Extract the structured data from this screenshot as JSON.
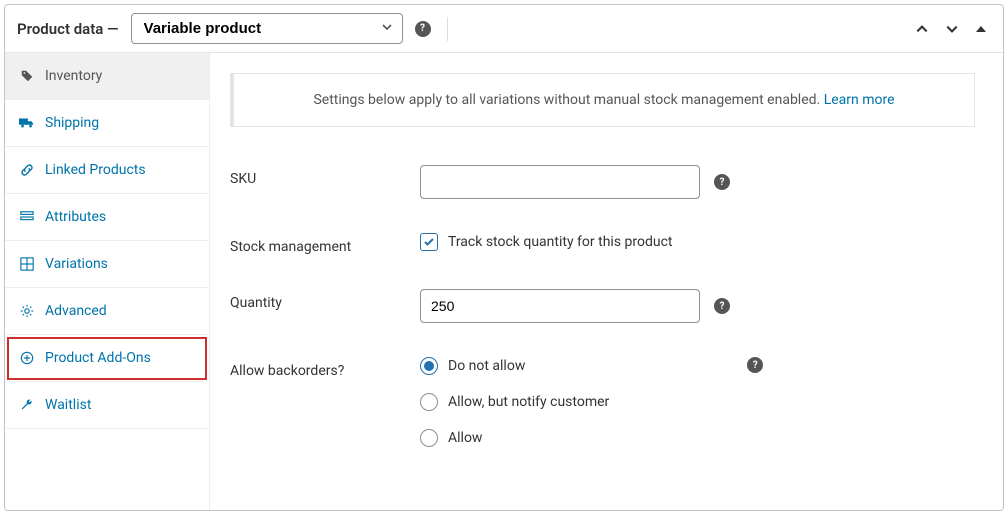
{
  "header": {
    "title": "Product data —",
    "product_type": "Variable product"
  },
  "tabs": [
    {
      "id": "inventory",
      "label": "Inventory",
      "active": true,
      "icon": "tag"
    },
    {
      "id": "shipping",
      "label": "Shipping",
      "icon": "truck"
    },
    {
      "id": "linked",
      "label": "Linked Products",
      "icon": "link"
    },
    {
      "id": "attributes",
      "label": "Attributes",
      "icon": "list"
    },
    {
      "id": "variations",
      "label": "Variations",
      "icon": "grid"
    },
    {
      "id": "advanced",
      "label": "Advanced",
      "icon": "gear"
    },
    {
      "id": "addons",
      "label": "Product Add-Ons",
      "icon": "plus-circle",
      "highlight": true
    },
    {
      "id": "waitlist",
      "label": "Waitlist",
      "icon": "wrench"
    }
  ],
  "notice": {
    "text": "Settings below apply to all variations without manual stock management enabled.",
    "link_text": "Learn more"
  },
  "fields": {
    "sku": {
      "label": "SKU",
      "value": ""
    },
    "stock_management": {
      "label": "Stock management",
      "checkbox_label": "Track stock quantity for this product",
      "checked": true
    },
    "quantity": {
      "label": "Quantity",
      "value": "250"
    },
    "backorders": {
      "label": "Allow backorders?",
      "selected": "no",
      "options": {
        "no": "Do not allow",
        "notify": "Allow, but notify customer",
        "yes": "Allow"
      }
    }
  }
}
